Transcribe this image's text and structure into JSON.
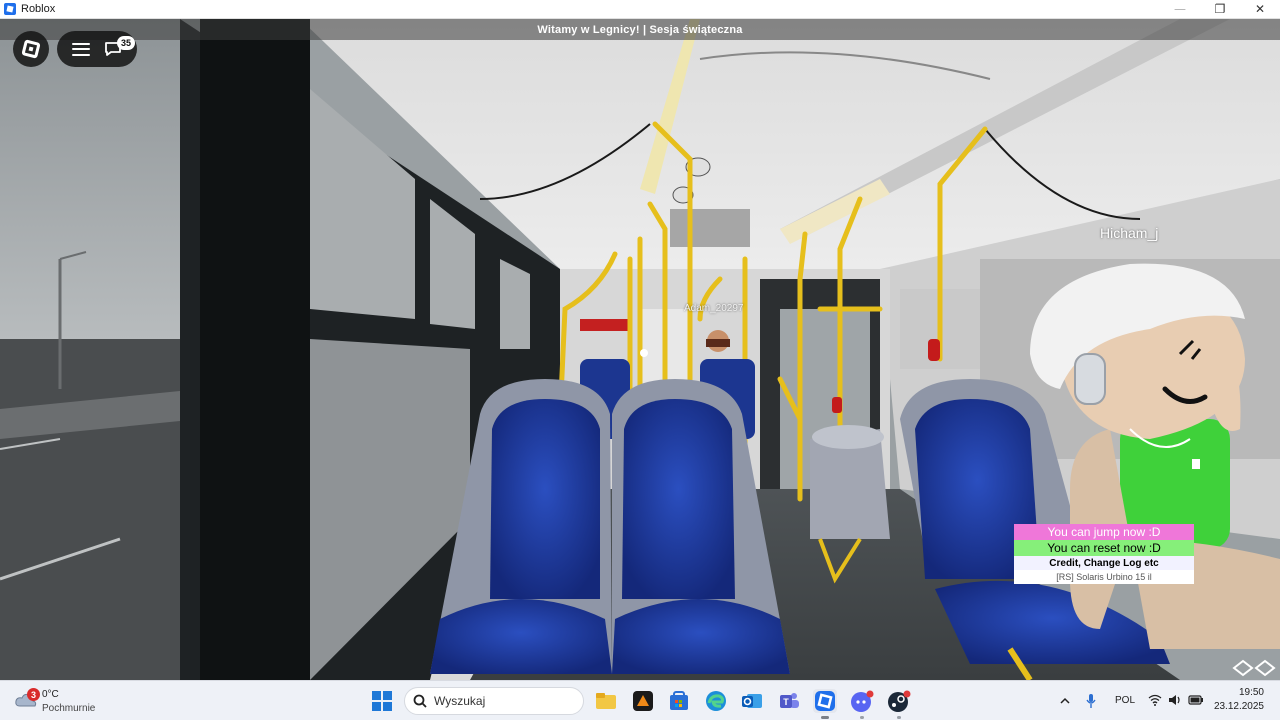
{
  "window": {
    "title": "Roblox",
    "controls": {
      "minimize": "—",
      "maximize": "❐",
      "close": "✕"
    }
  },
  "game": {
    "banner": "Witamy w Legnicy! | Sesja świąteczna",
    "chat_unread": "35",
    "players": [
      {
        "name": "Hicham_j"
      },
      {
        "name": "Adam_20297"
      }
    ],
    "info_panel": {
      "jump": "You can jump now :D",
      "reset": "You can reset now :D",
      "credit": "Credit, Change Log etc",
      "bus": "[RS] Solaris Urbino 15 il"
    }
  },
  "taskbar": {
    "weather": {
      "alert_count": "3",
      "temperature": "0°C",
      "condition": "Pochmurnie"
    },
    "search": {
      "placeholder": "Wyszukaj"
    },
    "tray": {
      "language": "POL"
    },
    "clock": {
      "time": "19:50",
      "date": "23.12.2025"
    }
  },
  "colors": {
    "seat_blue": "#1f3a9e",
    "pole_yellow": "#e6bf1c",
    "jump_pink": "#ef77d9",
    "reset_green": "#86ef7a",
    "taskbar_bg": "#eef1f7"
  }
}
